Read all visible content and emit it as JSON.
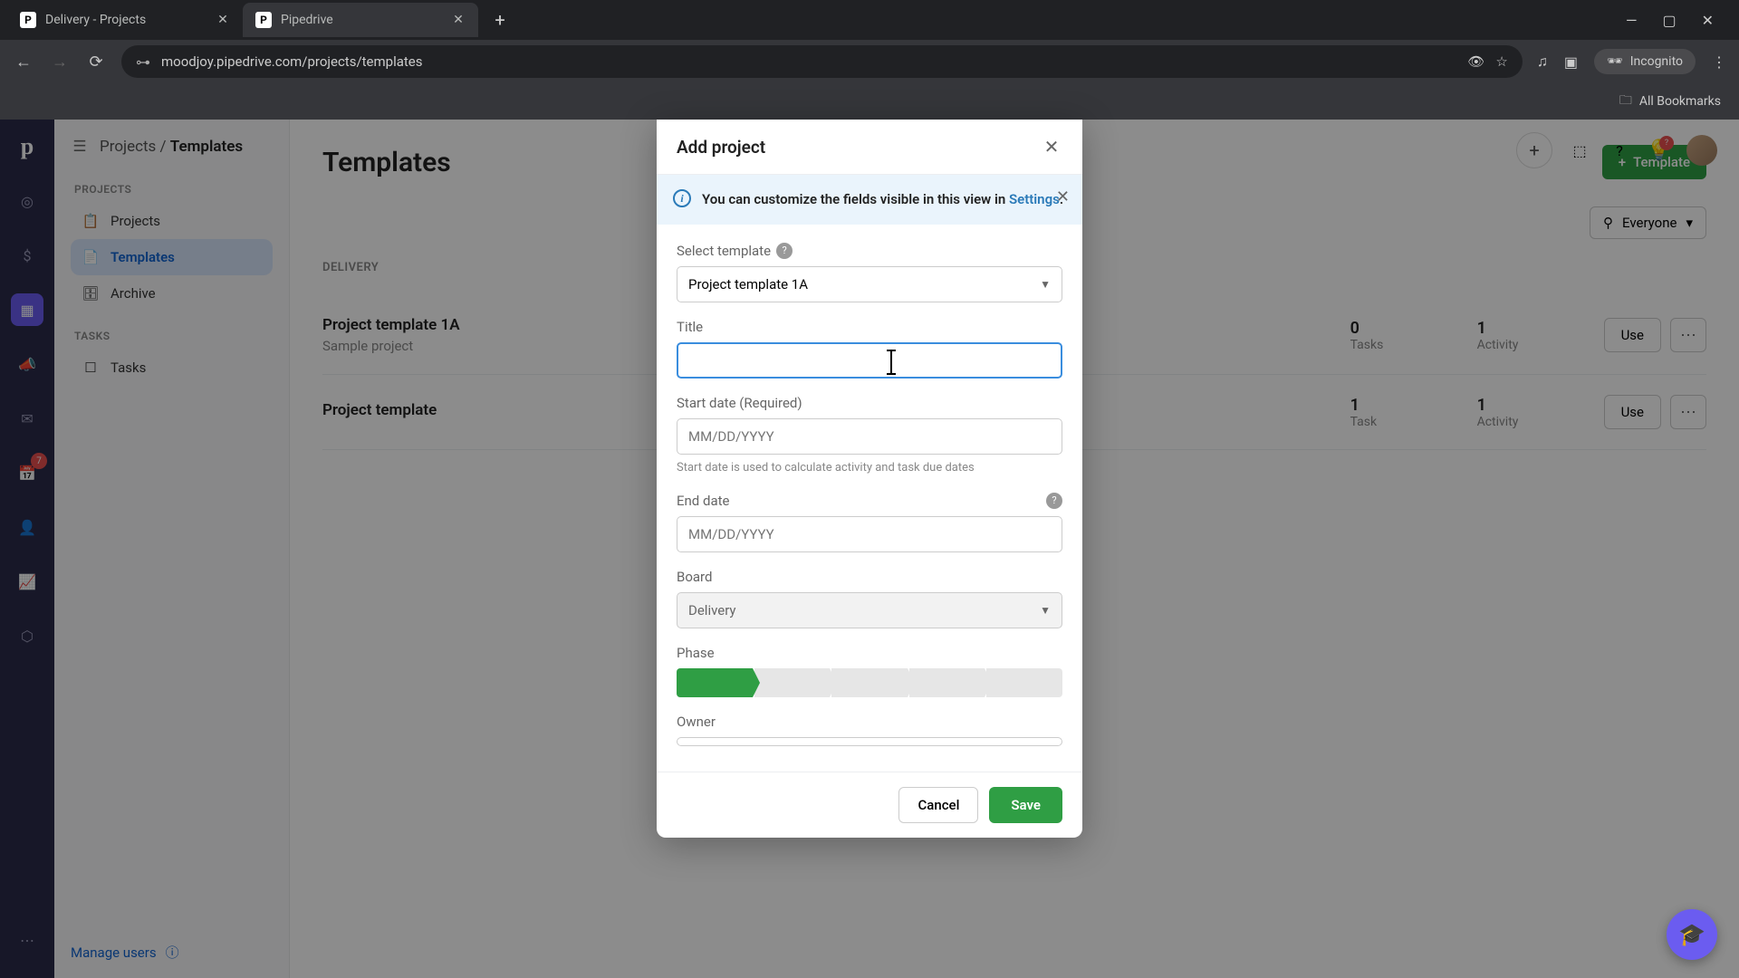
{
  "browser": {
    "tabs": [
      {
        "title": "Delivery - Projects",
        "active": false
      },
      {
        "title": "Pipedrive",
        "active": true
      }
    ],
    "url": "moodjoy.pipedrive.com/projects/templates",
    "incognito_label": "Incognito",
    "bookmarks_label": "All Bookmarks"
  },
  "rail": {
    "notif_count": "7"
  },
  "breadcrumb": {
    "parent": "Projects",
    "current": "Templates"
  },
  "sidebar": {
    "sections": [
      {
        "title": "PROJECTS",
        "items": [
          "Projects",
          "Templates",
          "Archive"
        ]
      },
      {
        "title": "TASKS",
        "items": [
          "Tasks"
        ]
      }
    ],
    "footer": "Manage users"
  },
  "main": {
    "title": "Templates",
    "add_button": "Template",
    "filter_label": "Everyone",
    "section_label": "DELIVERY",
    "templates": [
      {
        "name": "Project template 1A",
        "desc": "Sample project",
        "tasks_n": "0",
        "tasks_l": "Tasks",
        "act_n": "1",
        "act_l": "Activity"
      },
      {
        "name": "Project template",
        "desc": "",
        "tasks_n": "1",
        "tasks_l": "Task",
        "act_n": "1",
        "act_l": "Activity"
      }
    ],
    "use_label": "Use"
  },
  "top_right": {
    "lightbulb_notif": "?"
  },
  "modal": {
    "title": "Add project",
    "info": {
      "prefix": "You can customize the fields visible in this view in ",
      "link": "Settings",
      "suffix": "."
    },
    "fields": {
      "template_label": "Select template",
      "template_value": "Project template 1A",
      "title_label": "Title",
      "title_value": "",
      "start_label": "Start date (Required)",
      "start_placeholder": "MM/DD/YYYY",
      "start_hint": "Start date is used to calculate activity and task due dates",
      "end_label": "End date",
      "end_placeholder": "MM/DD/YYYY",
      "board_label": "Board",
      "board_value": "Delivery",
      "phase_label": "Phase",
      "owner_label": "Owner"
    },
    "cancel": "Cancel",
    "save": "Save"
  }
}
